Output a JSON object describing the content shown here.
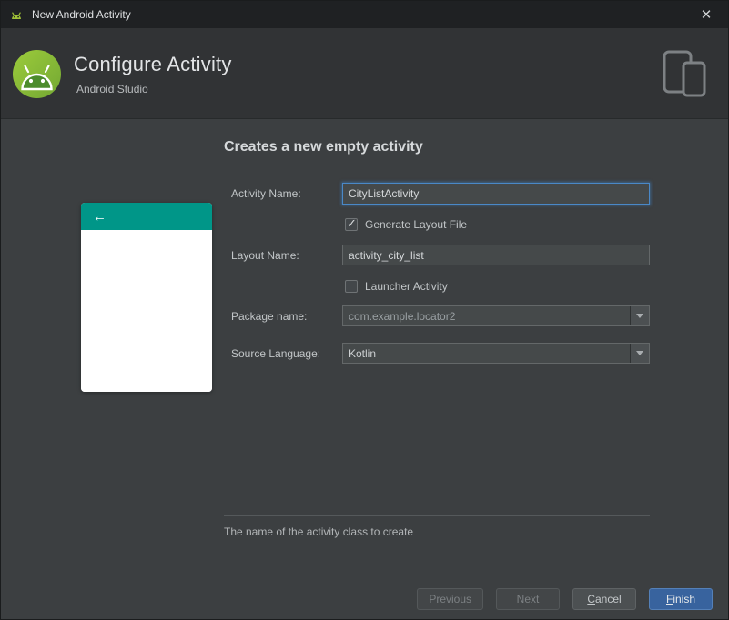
{
  "window": {
    "title": "New Android Activity"
  },
  "icons": {
    "close": "✕",
    "back": "←",
    "check": "✓"
  },
  "header": {
    "title": "Configure Activity",
    "subtitle": "Android Studio"
  },
  "content": {
    "heading": "Creates a new empty activity",
    "help_text": "The name of the activity class to create"
  },
  "fields": {
    "activity_name": {
      "label": "Activity Name:",
      "value": "CityListActivity"
    },
    "generate_layout": {
      "label": "Generate Layout File",
      "checked": true
    },
    "layout_name": {
      "label": "Layout Name:",
      "value": "activity_city_list"
    },
    "launcher": {
      "label": "Launcher Activity",
      "checked": false
    },
    "package": {
      "label": "Package name:",
      "value": "com.example.locator2"
    },
    "source_language": {
      "label": "Source Language:",
      "value": "Kotlin"
    }
  },
  "buttons": {
    "previous": "Previous",
    "next": "Next",
    "cancel_mnemonic": "C",
    "cancel_rest": "ancel",
    "finish_mnemonic": "F",
    "finish_rest": "inish"
  },
  "colors": {
    "accent_teal": "#009688",
    "focus_blue": "#4a88c7",
    "primary_button": "#38639e"
  }
}
